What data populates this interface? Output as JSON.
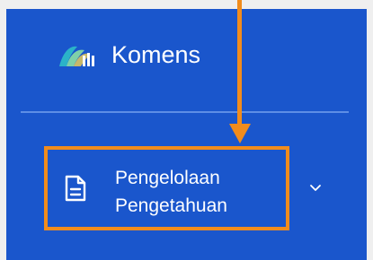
{
  "app": {
    "name": "Komens",
    "logo_icon": "komens-logo-icon"
  },
  "sidebar": {
    "items": [
      {
        "label_line1": "Pengelolaan",
        "label_line2": "Pengetahuan",
        "icon": "document-icon",
        "expand_icon": "chevron-down-icon",
        "highlighted": true
      }
    ]
  },
  "annotation": {
    "arrow_color": "#f28c1c",
    "highlight_color": "#f28c1c"
  },
  "colors": {
    "sidebar_bg": "#1a56cc",
    "page_bg": "#efefef",
    "text": "#ffffff"
  }
}
